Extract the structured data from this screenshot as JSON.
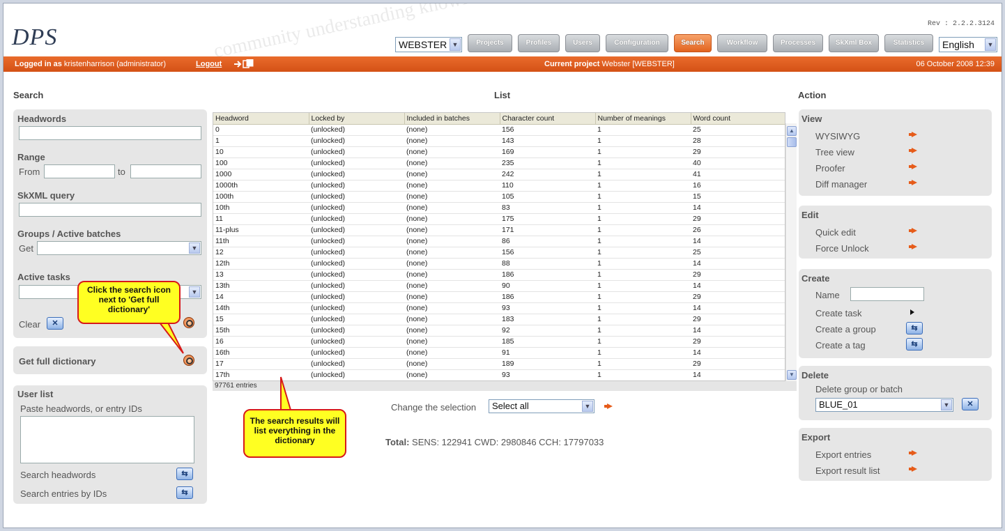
{
  "app": {
    "logo": "DPS",
    "rev": "Rev : 2.2.2.3124"
  },
  "project_select": {
    "value": "WEBSTER"
  },
  "nav": [
    "Projects",
    "Profiles",
    "Users",
    "Configuration",
    "Search",
    "Workflow",
    "Processes",
    "SkXml Box",
    "Statistics"
  ],
  "language": {
    "value": "English"
  },
  "statusbar": {
    "logged_label": "Logged in as",
    "user": "kristenharrison (administrator)",
    "logout": "Logout",
    "current_label": "Current project",
    "current_value": "Webster [WEBSTER]",
    "datetime": "06 October 2008 12:39"
  },
  "columns": {
    "search": "Search",
    "list": "List",
    "action": "Action"
  },
  "search": {
    "headwords": "Headwords",
    "range": "Range",
    "from": "From",
    "to": "to",
    "skxml": "SkXML query",
    "groups": "Groups / Active batches",
    "get": "Get",
    "tasks": "Active tasks",
    "clear": "Clear",
    "full_dict": "Get full dictionary",
    "userlist": "User list",
    "paste": "Paste headwords, or entry IDs",
    "search_hw": "Search headwords",
    "search_ids": "Search entries by IDs"
  },
  "table": {
    "headers": [
      "Headword",
      "Locked by",
      "Included in batches",
      "Character count",
      "Number of meanings",
      "Word count"
    ],
    "rows": [
      [
        "0",
        "(unlocked)",
        "(none)",
        "156",
        "1",
        "25"
      ],
      [
        "1",
        "(unlocked)",
        "(none)",
        "143",
        "1",
        "28"
      ],
      [
        "10",
        "(unlocked)",
        "(none)",
        "169",
        "1",
        "29"
      ],
      [
        "100",
        "(unlocked)",
        "(none)",
        "235",
        "1",
        "40"
      ],
      [
        "1000",
        "(unlocked)",
        "(none)",
        "242",
        "1",
        "41"
      ],
      [
        "1000th",
        "(unlocked)",
        "(none)",
        "110",
        "1",
        "16"
      ],
      [
        "100th",
        "(unlocked)",
        "(none)",
        "105",
        "1",
        "15"
      ],
      [
        "10th",
        "(unlocked)",
        "(none)",
        "83",
        "1",
        "14"
      ],
      [
        "11",
        "(unlocked)",
        "(none)",
        "175",
        "1",
        "29"
      ],
      [
        "11-plus",
        "(unlocked)",
        "(none)",
        "171",
        "1",
        "26"
      ],
      [
        "11th",
        "(unlocked)",
        "(none)",
        "86",
        "1",
        "14"
      ],
      [
        "12",
        "(unlocked)",
        "(none)",
        "156",
        "1",
        "25"
      ],
      [
        "12th",
        "(unlocked)",
        "(none)",
        "88",
        "1",
        "14"
      ],
      [
        "13",
        "(unlocked)",
        "(none)",
        "186",
        "1",
        "29"
      ],
      [
        "13th",
        "(unlocked)",
        "(none)",
        "90",
        "1",
        "14"
      ],
      [
        "14",
        "(unlocked)",
        "(none)",
        "186",
        "1",
        "29"
      ],
      [
        "14th",
        "(unlocked)",
        "(none)",
        "93",
        "1",
        "14"
      ],
      [
        "15",
        "(unlocked)",
        "(none)",
        "183",
        "1",
        "29"
      ],
      [
        "15th",
        "(unlocked)",
        "(none)",
        "92",
        "1",
        "14"
      ],
      [
        "16",
        "(unlocked)",
        "(none)",
        "185",
        "1",
        "29"
      ],
      [
        "16th",
        "(unlocked)",
        "(none)",
        "91",
        "1",
        "14"
      ],
      [
        "17",
        "(unlocked)",
        "(none)",
        "189",
        "1",
        "29"
      ],
      [
        "17th",
        "(unlocked)",
        "(none)",
        "93",
        "1",
        "14"
      ]
    ],
    "entries": "97761 entries"
  },
  "selection": {
    "label": "Change the selection",
    "value": "Select all"
  },
  "total": {
    "label": "Total:",
    "value": "SENS: 122941 CWD: 2980846 CCH: 17797033"
  },
  "callouts": {
    "search_icon": "Click the search icon next to 'Get full dictionary'",
    "results": "The search results will list everything in the dictionary"
  },
  "action": {
    "view": {
      "title": "View",
      "items": [
        "WYSIWYG",
        "Tree view",
        "Proofer",
        "Diff manager"
      ]
    },
    "edit": {
      "title": "Edit",
      "items": [
        "Quick edit",
        "Force Unlock"
      ]
    },
    "create": {
      "title": "Create",
      "name": "Name",
      "items": [
        "Create task",
        "Create a group",
        "Create a tag"
      ]
    },
    "delete": {
      "title": "Delete",
      "label": "Delete group or batch",
      "value": "BLUE_01"
    },
    "export": {
      "title": "Export",
      "items": [
        "Export entries",
        "Export result list"
      ]
    }
  },
  "colors": {
    "accent": "#e2631f",
    "callout_bg": "#ffff22",
    "callout_border": "#d71919"
  }
}
